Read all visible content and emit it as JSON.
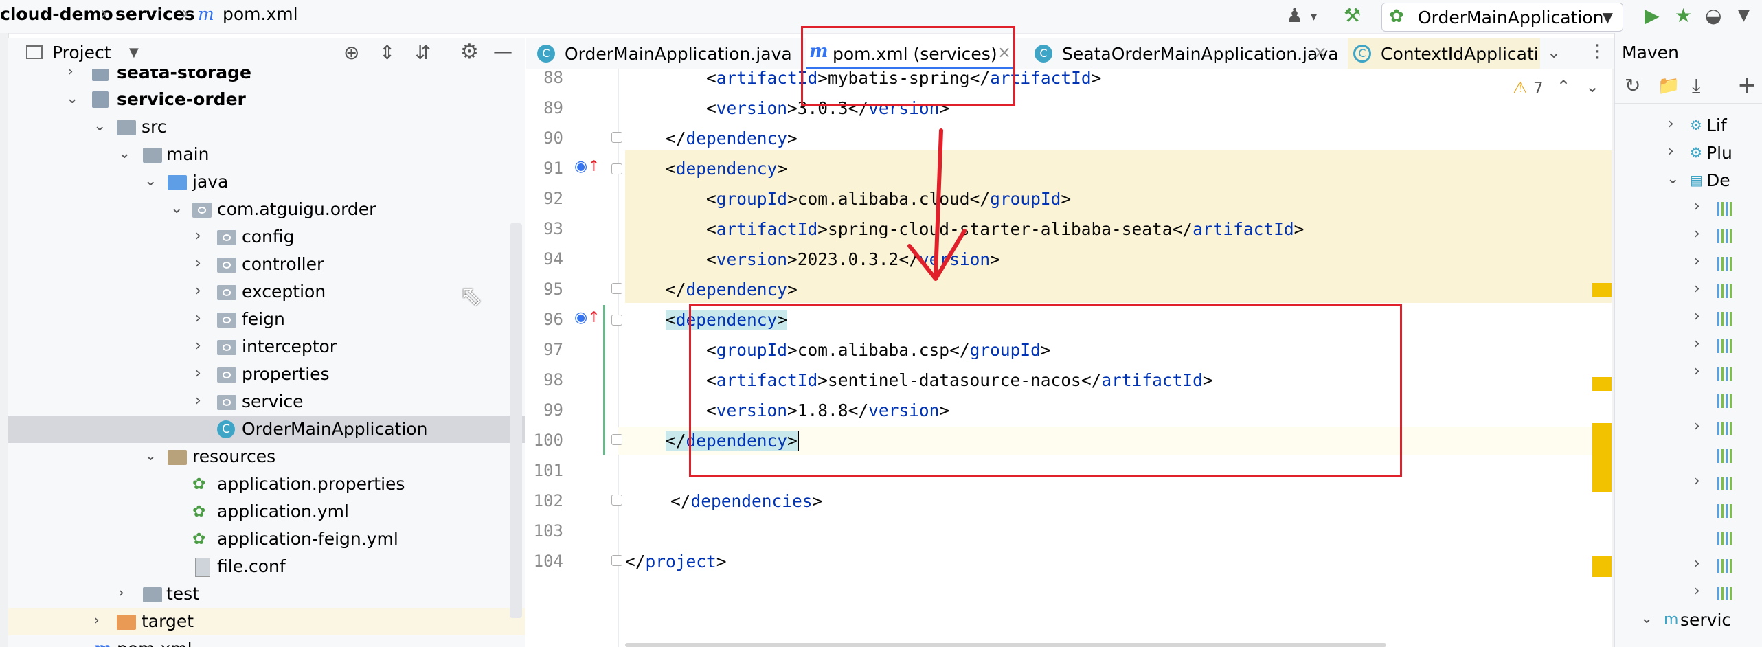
{
  "breadcrumb": {
    "project": "cloud-demo",
    "module": "services",
    "file": "pom.xml"
  },
  "toolbar": {
    "run_config": "OrderMainApplication"
  },
  "project_panel": {
    "title": "Project",
    "tree": [
      {
        "label": "seata-storage",
        "bold": true
      },
      {
        "label": "service-order",
        "bold": true
      },
      {
        "label": "src"
      },
      {
        "label": "main"
      },
      {
        "label": "java"
      },
      {
        "label": "com.atguigu.order"
      },
      {
        "label": "config"
      },
      {
        "label": "controller"
      },
      {
        "label": "exception"
      },
      {
        "label": "feign"
      },
      {
        "label": "interceptor"
      },
      {
        "label": "properties"
      },
      {
        "label": "service"
      },
      {
        "label": "OrderMainApplication"
      },
      {
        "label": "resources"
      },
      {
        "label": "application.properties"
      },
      {
        "label": "application.yml"
      },
      {
        "label": "application-feign.yml"
      },
      {
        "label": "file.conf"
      },
      {
        "label": "test"
      },
      {
        "label": "target"
      },
      {
        "label": "pom.xml"
      }
    ]
  },
  "tabs": [
    {
      "label": "OrderMainApplication.java"
    },
    {
      "label": "pom.xml (services)",
      "active": true
    },
    {
      "label": "SeataOrderMainApplication.java"
    },
    {
      "label": "ContextIdApplicati"
    }
  ],
  "editor": {
    "warnings": "7",
    "lines": [
      {
        "num": "88",
        "indent": "        ",
        "open": "artifactId",
        "text": "mybatis-spring",
        "close": "artifactId"
      },
      {
        "num": "89",
        "indent": "        ",
        "open": "version",
        "text": "3.0.3",
        "close": "version"
      },
      {
        "num": "90",
        "indent": "    ",
        "close_only": "dependency"
      },
      {
        "num": "91",
        "indent": "    ",
        "open_only": "dependency"
      },
      {
        "num": "92",
        "indent": "        ",
        "open": "groupId",
        "text": "com.alibaba.cloud",
        "close": "groupId"
      },
      {
        "num": "93",
        "indent": "        ",
        "open": "artifactId",
        "text": "spring-cloud-starter-alibaba-seata",
        "close": "artifactId"
      },
      {
        "num": "94",
        "indent": "        ",
        "open": "version",
        "text": "2023.0.3.2",
        "close": "version"
      },
      {
        "num": "95",
        "indent": "    ",
        "close_only": "dependency"
      },
      {
        "num": "96",
        "indent": "    ",
        "open_only": "dependency"
      },
      {
        "num": "97",
        "indent": "        ",
        "open": "groupId",
        "text": "com.alibaba.csp",
        "close": "groupId"
      },
      {
        "num": "98",
        "indent": "        ",
        "open": "artifactId",
        "text": "sentinel-datasource-nacos",
        "close": "artifactId"
      },
      {
        "num": "99",
        "indent": "        ",
        "open": "version",
        "text": "1.8.8",
        "close": "version"
      },
      {
        "num": "100",
        "indent": "    ",
        "close_only": "dependency"
      },
      {
        "num": "101"
      },
      {
        "num": "102",
        "indent": "",
        "close_only": "dependencies"
      },
      {
        "num": "103"
      },
      {
        "num": "104",
        "indent": "",
        "close_only": "project",
        "no_indent_base": true
      }
    ]
  },
  "maven": {
    "title": "Maven",
    "rows": [
      {
        "label": "Lif"
      },
      {
        "label": "Plu"
      },
      {
        "label": "De"
      },
      {
        "label": "servic"
      }
    ]
  },
  "colors": {
    "accent": "#3574f0",
    "annotation_red": "#e0202a",
    "tag": "#0033b3",
    "highlight_yellow": "#fbf3d6"
  }
}
